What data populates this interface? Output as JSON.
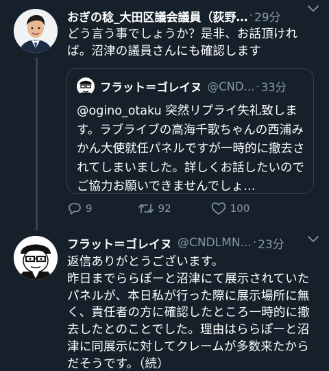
{
  "tweets": [
    {
      "author": {
        "name": "おぎの稔_大田区議会議員（荻野…",
        "handle": "",
        "avatar": "politician-avatar"
      },
      "separator": "·",
      "time": "29分",
      "text": "どう言う事でしょうか？是非、お話頂ければ。沼津の議員さんにも確認します",
      "quoted": {
        "author": {
          "name": "フラット＝ゴレイヌ",
          "handle": "@CND...",
          "avatar": "manga-character-avatar"
        },
        "separator": "·",
        "time": "33分",
        "text": "@ogino_otaku 突然リプライ失礼致します。ラブライブの高海千歌ちゃんの西浦みかん大使就任パネルですが一時的に撤去されてしまいました。詳しくお話したいのでご協力お願いできませんでしょ…"
      },
      "actions": {
        "reply_count": "9",
        "retweet_count": "92",
        "like_count": "100"
      }
    },
    {
      "author": {
        "name": "フラット＝ゴレイヌ",
        "handle": "@CNDLMN...",
        "avatar": "manga-character-avatar"
      },
      "separator": "·",
      "time": "23分",
      "text": "返信ありがとうございます。\n昨日までららぽーと沼津にて展示されていたパネルが、本日私が行った際に展示場所に無く、責任者の方に確認したところ一時的に撤去したとのことでした。理由はららぽーと沼津に同展示に対してクレームが多数来たからだそうです。（続）"
    }
  ],
  "colors": {
    "background": "#15202b",
    "text_primary": "#ffffff",
    "text_secondary": "#8899a6",
    "border": "#38444d"
  },
  "icons": {
    "reply": "reply-icon",
    "retweet": "retweet-icon",
    "like": "heart-icon",
    "menu": "chevron-down-icon"
  }
}
